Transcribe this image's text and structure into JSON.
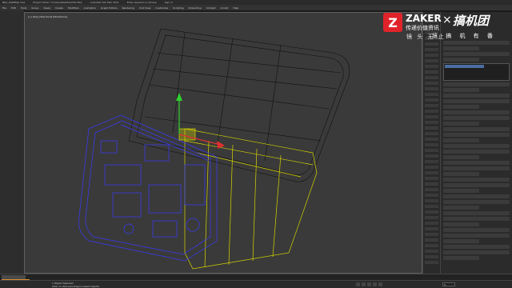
{
  "window": {
    "title": "B&S_ZAKER@.max",
    "project": "Project folder: C:\\Users\\Desktop\\3ds Max",
    "app": "Autodesk 3ds Max 2021",
    "search": "Enter keyword or phrase",
    "sign_in": "Sign In"
  },
  "menu": {
    "items": [
      "File",
      "Edit",
      "Tools",
      "Group",
      "Views",
      "Create",
      "Modifiers",
      "Animation",
      "Graph Editors",
      "Rendering",
      "Civil View",
      "Customize",
      "Scripting",
      "Interactive",
      "Content",
      "Arnold",
      "Help"
    ]
  },
  "viewport": {
    "label": "[+] [Top] [Standard] [Wireframe]"
  },
  "overlay": {
    "line1": "镜  头  无  止",
    "line2": "境  搞  机  有  番"
  },
  "logo": {
    "badge": "Z",
    "name": "ZAKER",
    "tagline": "传递价值资讯",
    "x": "×",
    "partner": "搞机团"
  },
  "status": {
    "selected": "1 Object Selected",
    "hint": "Click or click-and-drag to select objects",
    "frame": "0"
  },
  "colors": {
    "accent": "#e0232a",
    "wire_blue": "#3a3aff",
    "wire_yellow": "#d6d600",
    "wire_black": "#111111",
    "gizmo_green": "#2fd12f",
    "timeline_orange": "#d98e2c"
  }
}
